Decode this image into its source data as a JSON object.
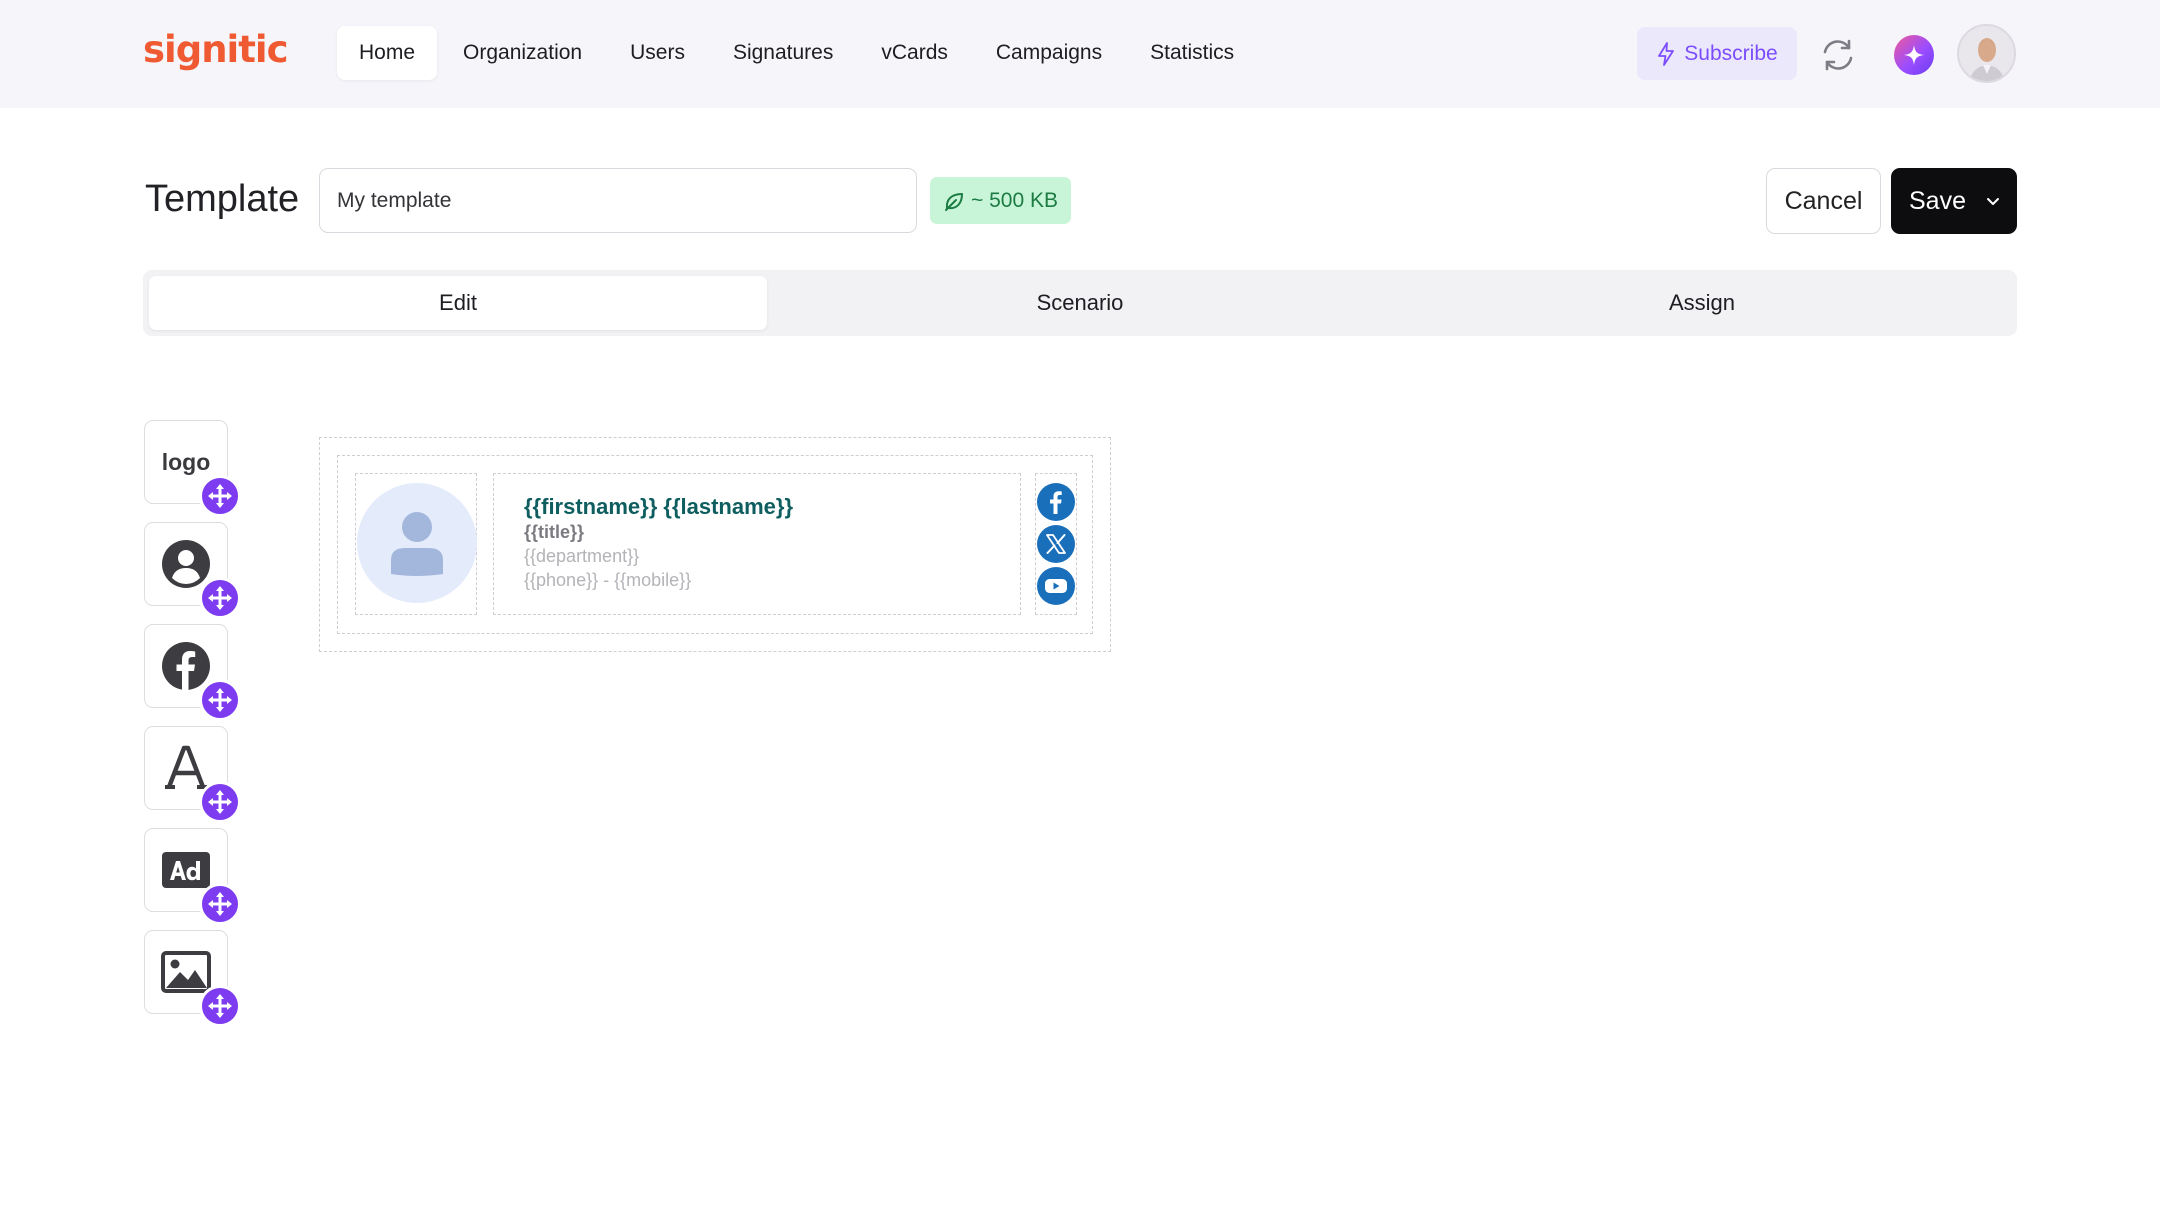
{
  "brand": {
    "logo_text": "signitic",
    "color": "#ef5a33"
  },
  "nav": {
    "items": [
      {
        "label": "Home",
        "active": true
      },
      {
        "label": "Organization",
        "active": false
      },
      {
        "label": "Users",
        "active": false
      },
      {
        "label": "Signatures",
        "active": false
      },
      {
        "label": "vCards",
        "active": false
      },
      {
        "label": "Campaigns",
        "active": false
      },
      {
        "label": "Statistics",
        "active": false
      }
    ],
    "subscribe_label": "Subscribe",
    "icons": [
      "lightning-icon",
      "sync-icon",
      "sparkle-icon",
      "user-avatar"
    ]
  },
  "header": {
    "title": "Template",
    "template_name_value": "My template",
    "size_badge": "~ 500 KB",
    "cancel_label": "Cancel",
    "save_label": "Save"
  },
  "tabs": [
    {
      "label": "Edit",
      "active": true
    },
    {
      "label": "Scenario",
      "active": false
    },
    {
      "label": "Assign",
      "active": false
    }
  ],
  "blocks": [
    {
      "name": "logo",
      "label": "logo"
    },
    {
      "name": "user-photo",
      "icon": "user-circle-icon"
    },
    {
      "name": "social",
      "icon": "facebook-icon"
    },
    {
      "name": "text",
      "icon": "font-letter-icon"
    },
    {
      "name": "banner",
      "icon": "ad-icon"
    },
    {
      "name": "image",
      "icon": "image-icon"
    }
  ],
  "signature": {
    "name": "{{firstname}} {{lastname}}",
    "title": "{{title}}",
    "department": "{{department}}",
    "phone_line": "{{phone}} - {{mobile}}",
    "socials": [
      "facebook",
      "x",
      "youtube"
    ]
  },
  "colors": {
    "accent_purple": "#7d3cf0",
    "name_teal": "#0e5e60",
    "social_blue": "#1a6fba",
    "badge_green_bg": "#c8f5d7",
    "badge_green_text": "#1c7c44"
  }
}
